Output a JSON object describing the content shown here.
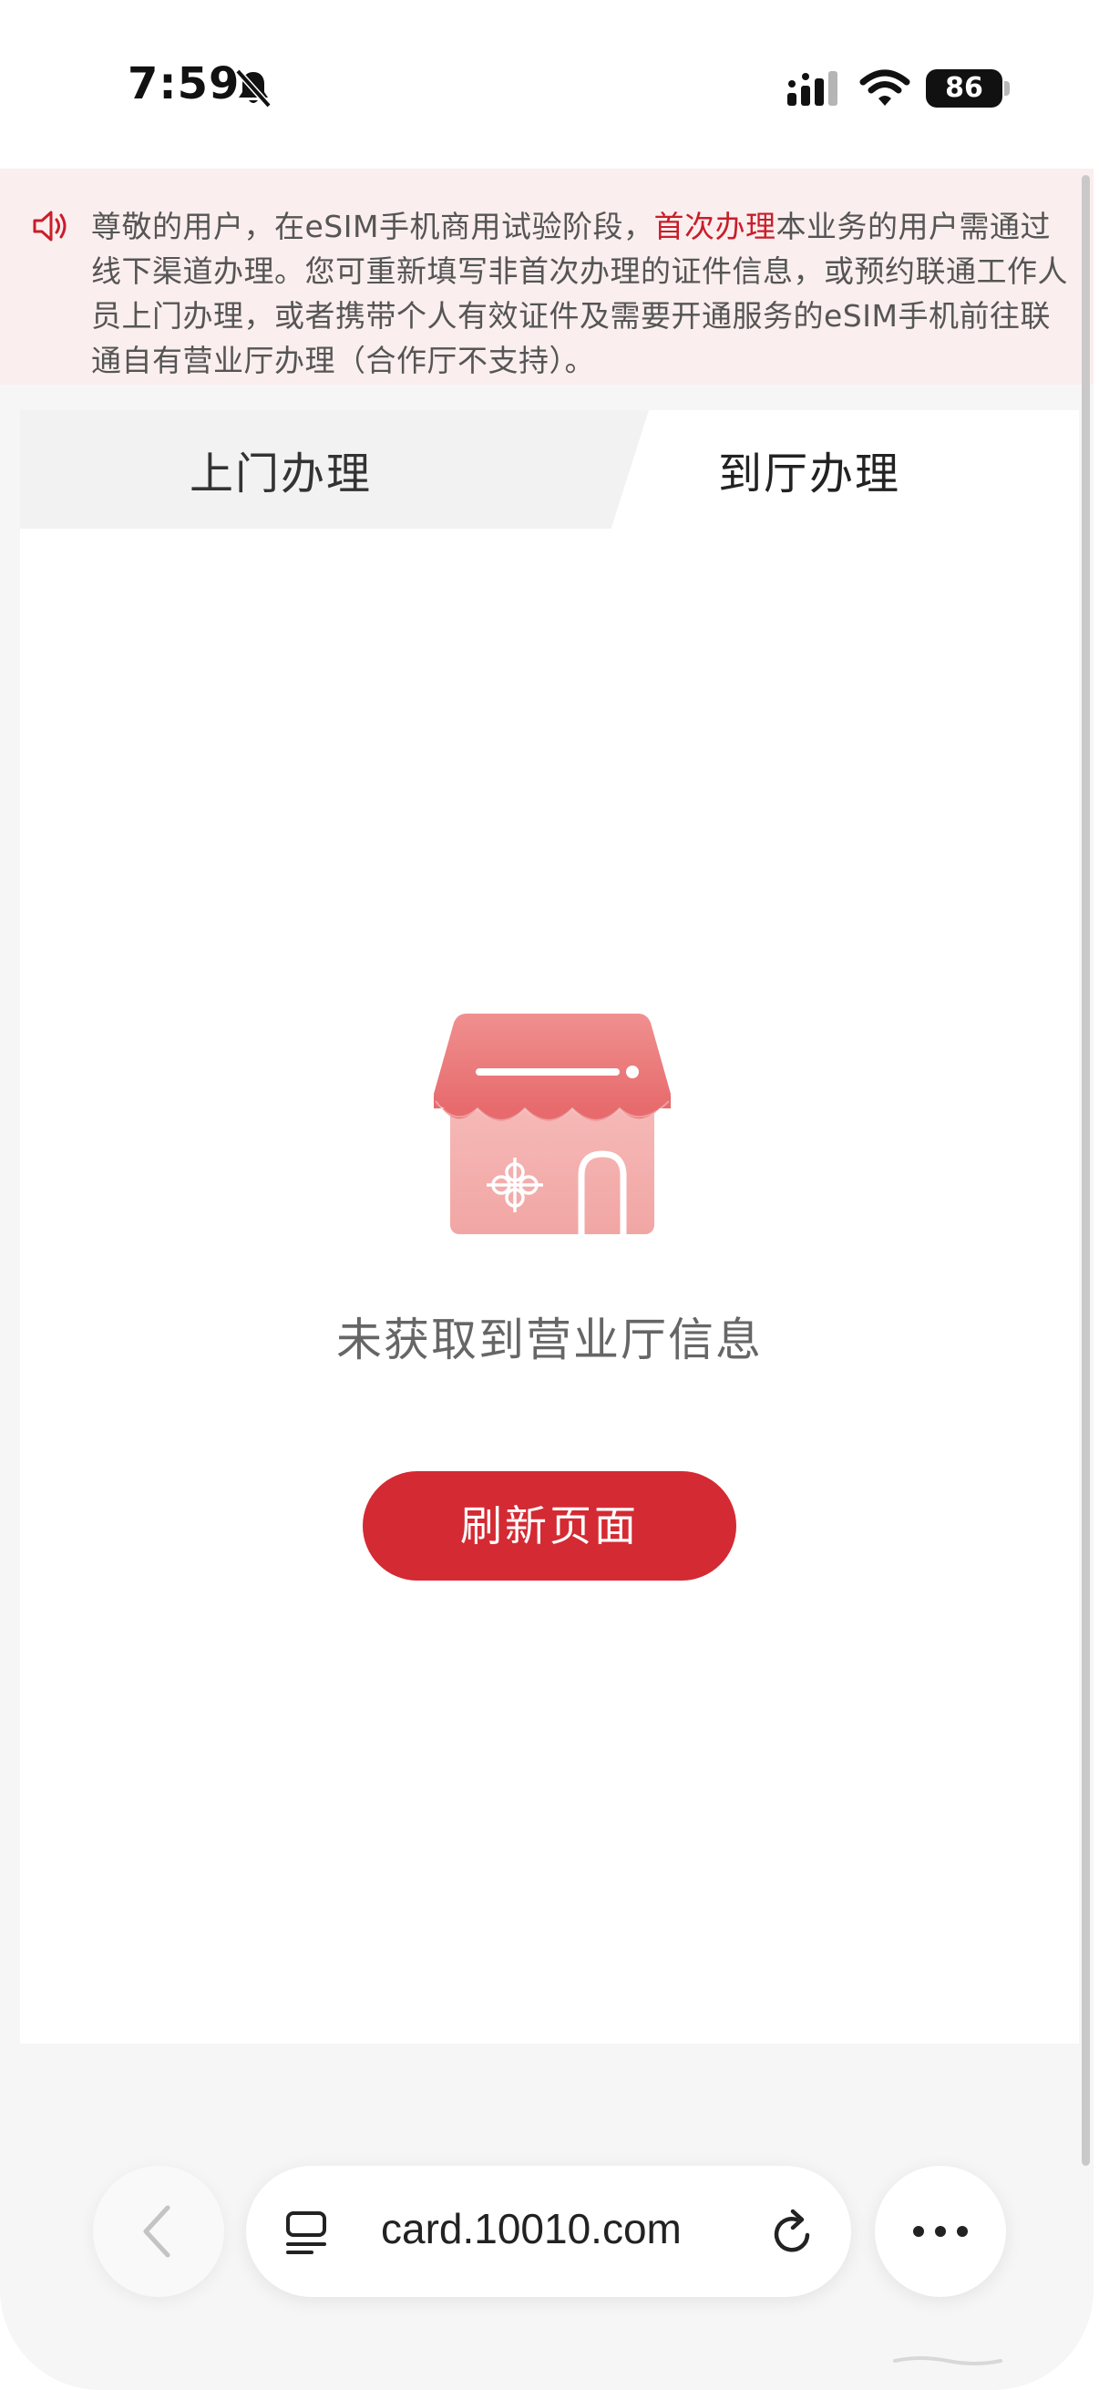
{
  "status_bar": {
    "time": "7:59",
    "battery": "86",
    "icons": [
      "bell-slash-icon",
      "cellular-signal-icon",
      "wifi-icon",
      "battery-icon"
    ]
  },
  "notice": {
    "icon": "speaker-icon",
    "text_before": "尊敬的用户，在eSIM手机商用试验阶段，",
    "highlight": "首次办理",
    "text_after": "本业务的用户需通过线下渠道办理。您可重新填写非首次办理的证件信息，或预约联通工作人员上门办理，或者携带个人有效证件及需要开通服务的eSIM手机前往联通自有营业厅办理（合作厅不支持）。",
    "highlight_color": "#c81e2a"
  },
  "tabs": [
    {
      "label": "上门办理",
      "active": false
    },
    {
      "label": "到厅办理",
      "active": true
    }
  ],
  "empty_state": {
    "icon": "storefront-icon",
    "message": "未获取到营业厅信息",
    "button_label": "刷新页面"
  },
  "browser_bar": {
    "url": "card.10010.com",
    "icons": [
      "back-chevron-icon",
      "reader-icon",
      "reload-icon",
      "more-icon"
    ]
  },
  "colors": {
    "accent": "#d42a33",
    "notice_bg": "#fbeeee"
  }
}
